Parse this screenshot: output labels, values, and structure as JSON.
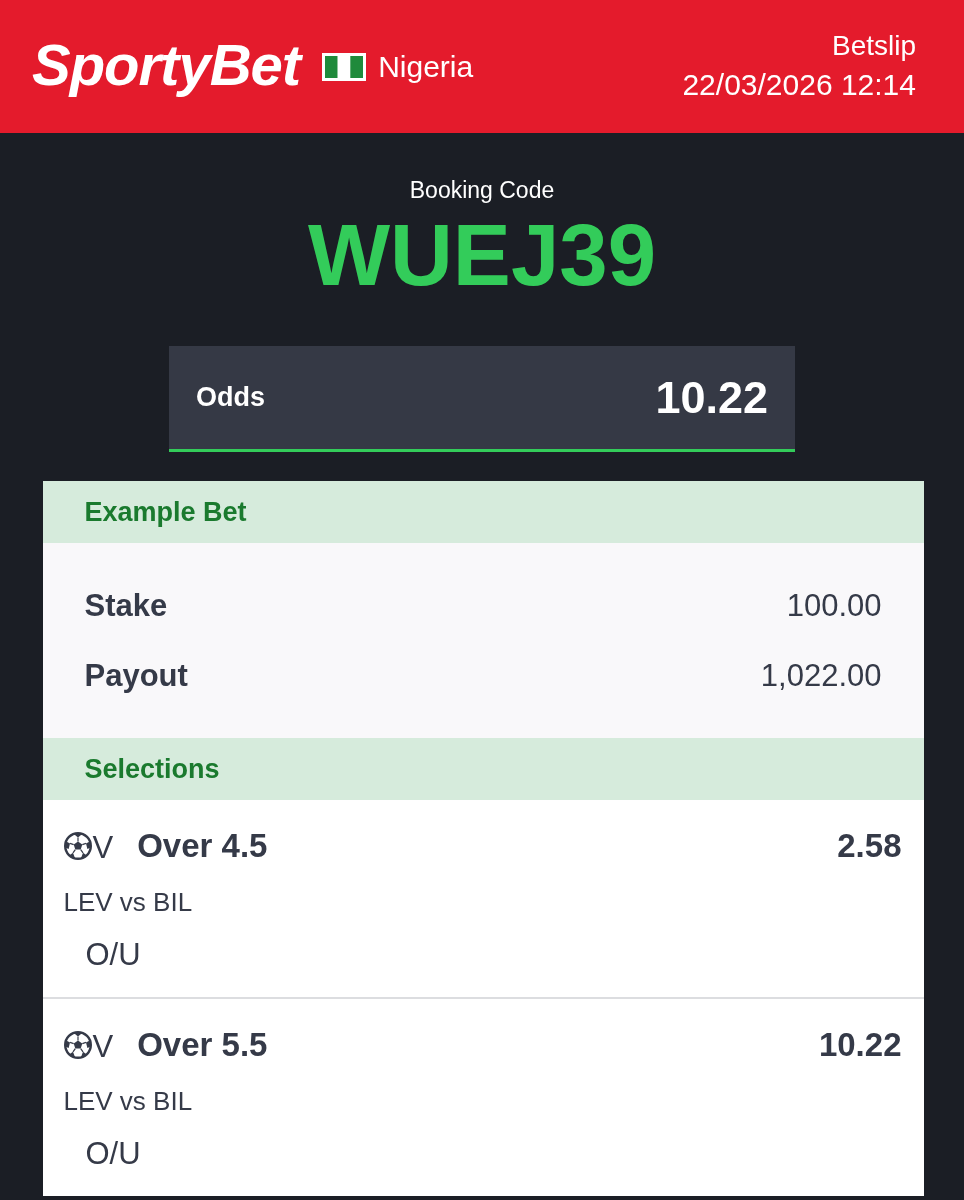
{
  "header": {
    "logo": "SportyBet",
    "country": "Nigeria",
    "title": "Betslip",
    "datetime": "22/03/2026 12:14"
  },
  "booking": {
    "label": "Booking Code",
    "code": "WUEJ39"
  },
  "odds": {
    "label": "Odds",
    "value": "10.22"
  },
  "example_bet": {
    "title": "Example Bet",
    "rows": [
      {
        "label": "Stake",
        "value": "100.00"
      },
      {
        "label": "Payout",
        "value": "1,022.00"
      }
    ]
  },
  "selections": {
    "title": "Selections",
    "items": [
      {
        "tag": "V",
        "pick": "Over 4.5",
        "odds": "2.58",
        "match": "LEV vs BIL",
        "market": "O/U"
      },
      {
        "tag": "V",
        "pick": "Over 5.5",
        "odds": "10.22",
        "match": "LEV vs BIL",
        "market": "O/U"
      }
    ]
  }
}
